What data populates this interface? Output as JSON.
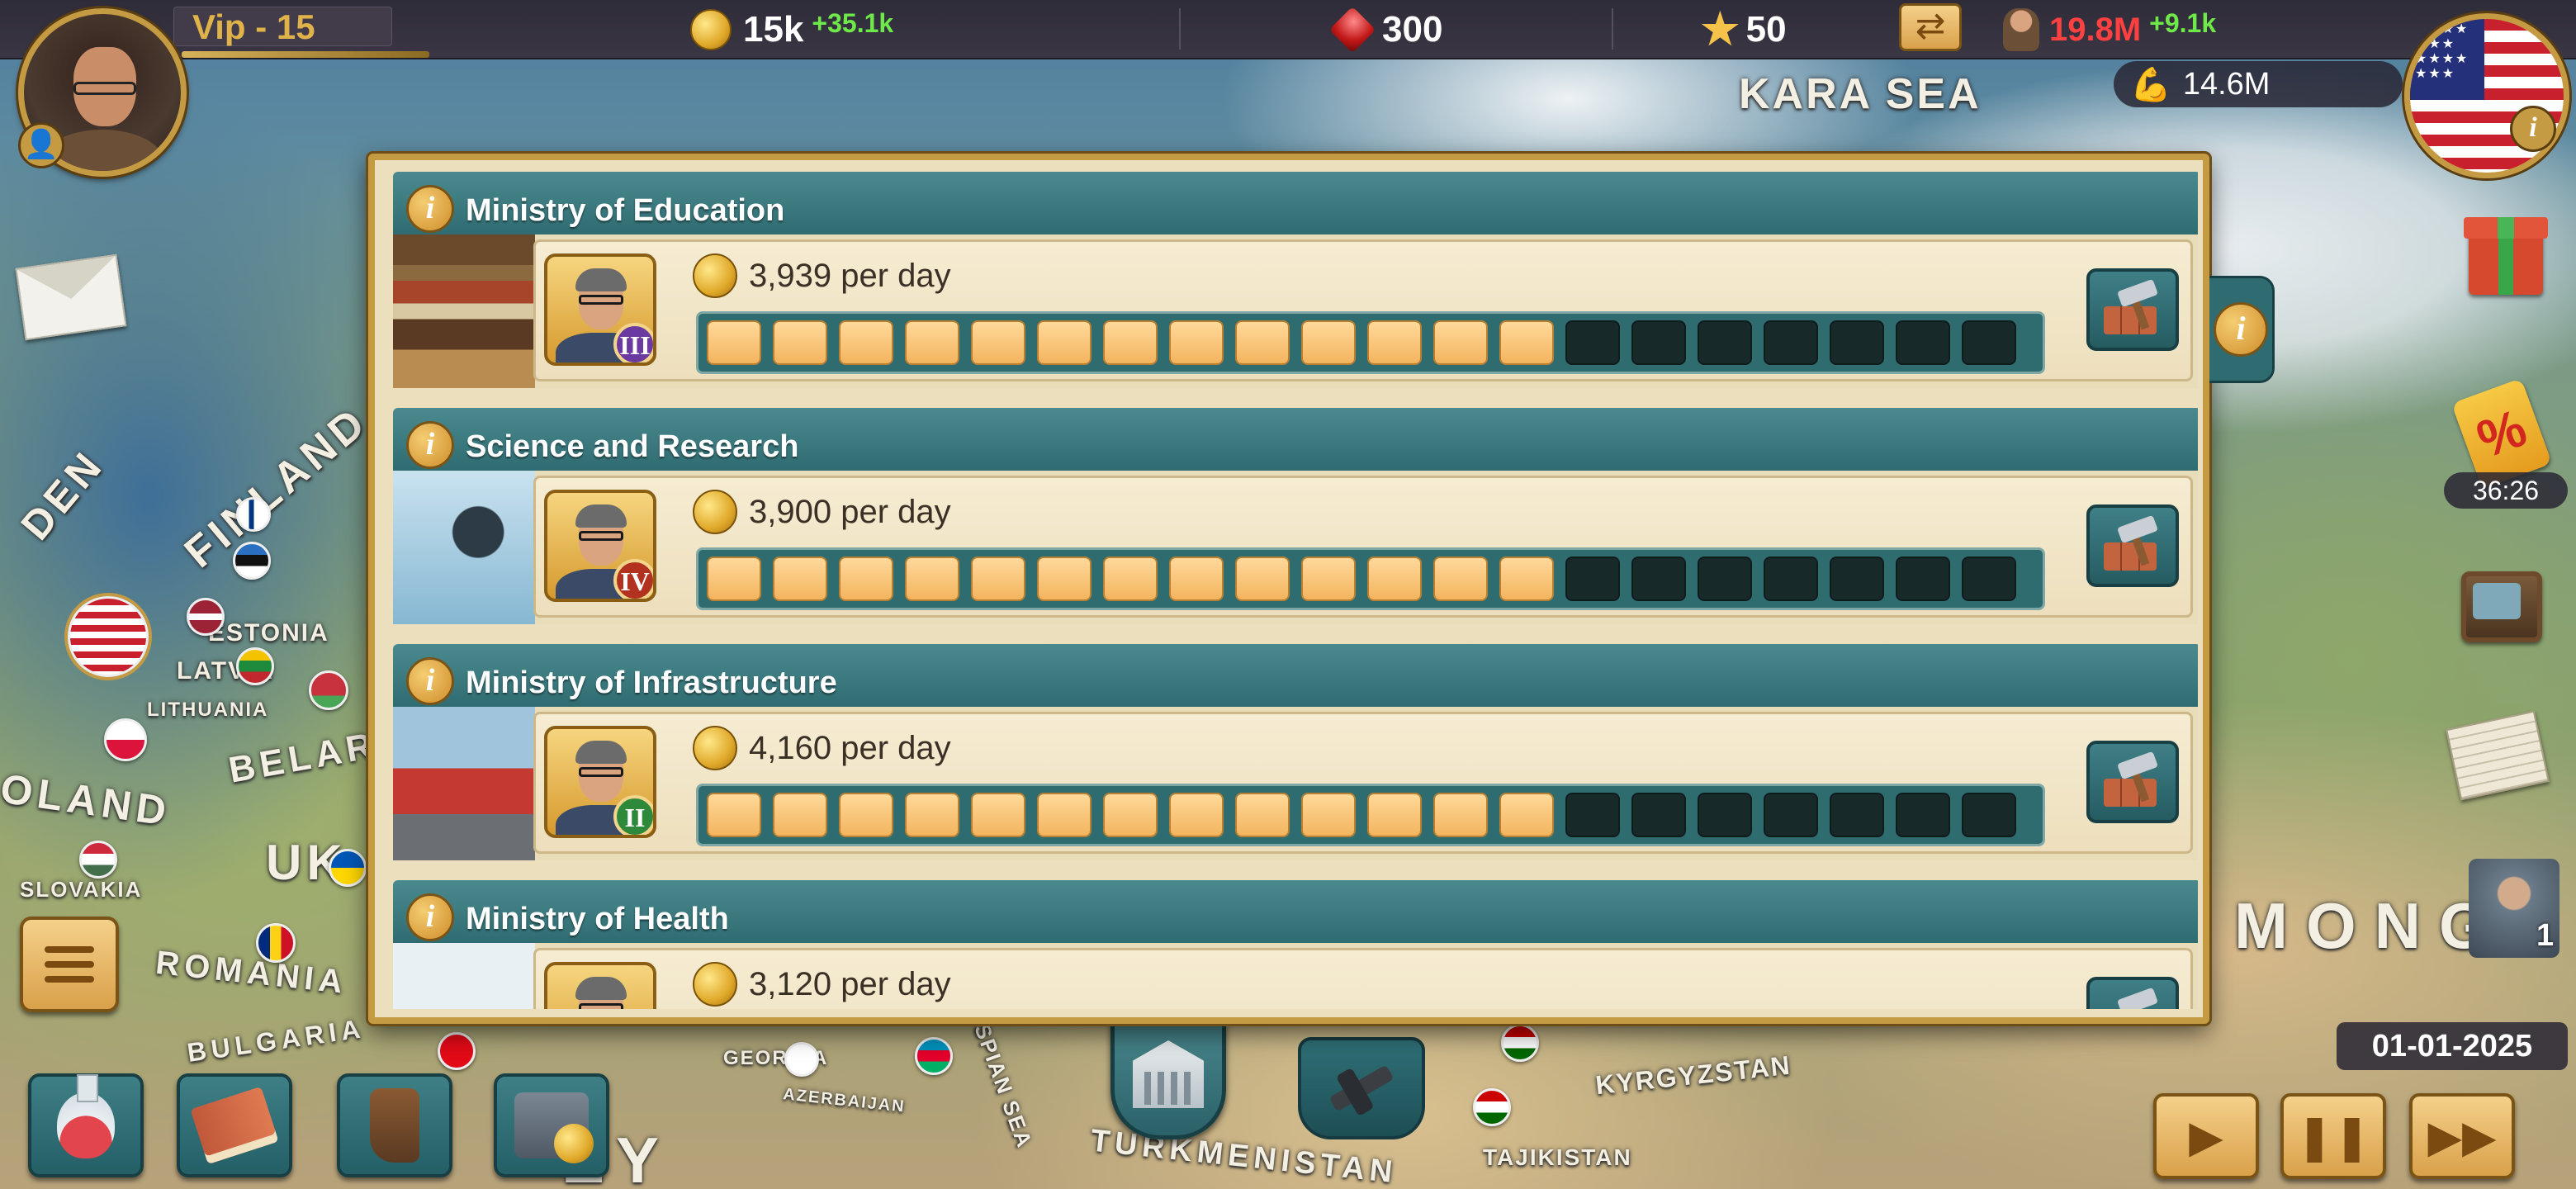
{
  "topbar": {
    "vip_label": "Vip  - 15",
    "gold": "15k",
    "gold_delta": "+35.1k",
    "gems": "300",
    "stars": "50",
    "population": "19.8M",
    "population_delta": "+9.1k",
    "military": "14.6M"
  },
  "map_labels": {
    "kara_sea": "KARA SEA",
    "finland": "FINLAND",
    "sweden": "DEN",
    "estonia": "ESTONIA",
    "latvia": "LATVIA",
    "lithuania": "LITHUANIA",
    "belarus": "BELARU",
    "poland": "OLAND",
    "ukraine": "UK",
    "slovakia": "SLOVAKIA",
    "romania": "ROMANIA",
    "bulgaria": "BULGARIA",
    "georgia": "GEORGIA",
    "azerbaijan": "AZERBAIJAN",
    "caspian": "SPIAN SEA",
    "turkmenistan": "TURKMENISTAN",
    "kyrgyzstan": "KYRGYZSTAN",
    "tajikistan": "TAJIKISTAN",
    "mongolia": "MONG",
    "turkey": "EY"
  },
  "panel": {
    "ministries": [
      {
        "title": "Ministry of Education",
        "income": "3,939 per day",
        "rank": "III",
        "rank_color": "#6a3aa0",
        "filled": 13,
        "total": 20,
        "image": "books"
      },
      {
        "title": "Science and Research",
        "income": "3,900 per day",
        "rank": "IV",
        "rank_color": "#b2311f",
        "filled": 13,
        "total": 20,
        "image": "microscope"
      },
      {
        "title": "Ministry of Infrastructure",
        "income": "4,160 per day",
        "rank": "II",
        "rank_color": "#2e8a3a",
        "filled": 13,
        "total": 20,
        "image": "truck"
      },
      {
        "title": "Ministry of Health",
        "income": "3,120 per day",
        "rank": "",
        "rank_color": "#2e8a3a",
        "filled": 13,
        "total": 20,
        "image": "hospital"
      }
    ]
  },
  "sidebar": {
    "sale_timer": "36:26",
    "advisor_count": "1"
  },
  "bottom": {
    "date": "01-01-2025"
  },
  "icons": {
    "info": "i"
  },
  "colors": {
    "panel_header": "#2f6c72",
    "bar_on": "#f3b45e",
    "bar_off": "#172a29",
    "gold_frame": "#c49a42",
    "delta_green": "#6fe84a",
    "population_red": "#ff4040"
  }
}
